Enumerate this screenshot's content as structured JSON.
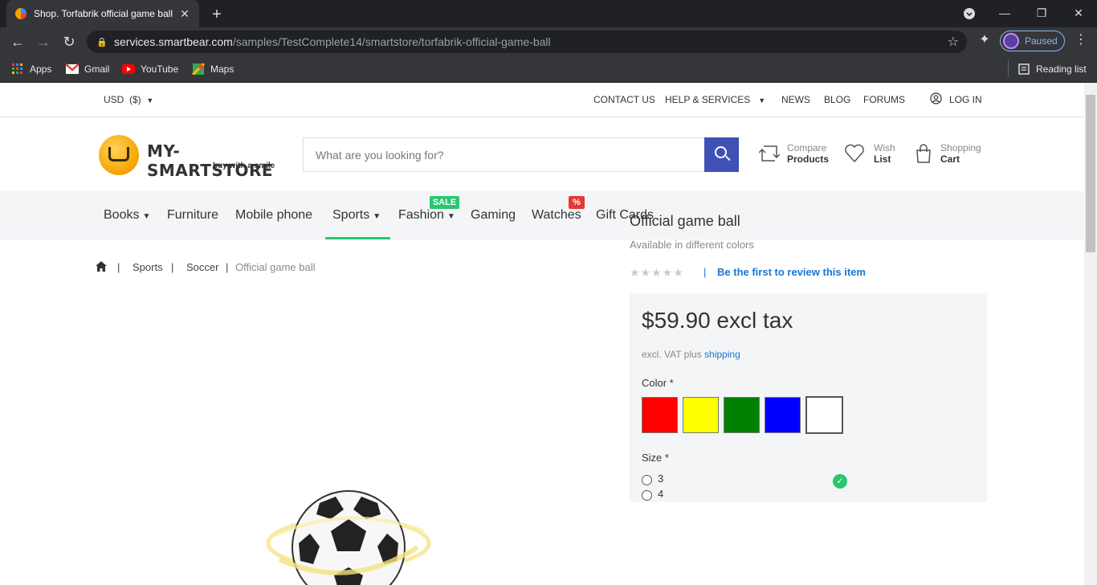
{
  "browser": {
    "tab_title": "Shop. Torfabrik official game ball",
    "url_host": "services.smartbear.com",
    "url_path": "/samples/TestComplete14/smartstore/torfabrik-official-game-ball",
    "profile_status": "Paused",
    "bookmarks": [
      "Apps",
      "Gmail",
      "YouTube",
      "Maps"
    ],
    "reading_list": "Reading list"
  },
  "topbar": {
    "currency": "USD",
    "currency_symbol": "($)",
    "contact": "CONTACT US",
    "help": "HELP & SERVICES",
    "news": "NEWS",
    "blog": "BLOG",
    "forums": "FORUMS",
    "login": "LOG IN"
  },
  "header": {
    "logo_name": "MY-SMARTSTORE",
    "logo_tagline": "buy with a smile",
    "search_placeholder": "What are you looking for?",
    "compare_l1": "Compare",
    "compare_l2": "Products",
    "wish_l1": "Wish",
    "wish_l2": "List",
    "cart_l1": "Shopping",
    "cart_l2": "Cart"
  },
  "menu": {
    "books": "Books",
    "furniture": "Furniture",
    "mobile": "Mobile phone",
    "sports": "Sports",
    "fashion": "Fashion",
    "gaming": "Gaming",
    "watches": "Watches",
    "giftcards": "Gift Cards",
    "sale_badge": "SALE",
    "pct_badge": "%"
  },
  "breadcrumb": {
    "sep": "|",
    "sports": "Sports",
    "soccer": "Soccer",
    "current": "Official game ball"
  },
  "product": {
    "title": "Official game ball",
    "subtitle": "Available in different colors",
    "stars": "★★★★★",
    "review_sep": "|",
    "review_link": "Be the first to review this item",
    "price": "$59.90 excl tax",
    "vat_text": "excl. VAT plus",
    "shipping_link": "shipping",
    "color_label": "Color *",
    "colors": [
      "#ff0000",
      "#ffff00",
      "#008000",
      "#0000ff",
      "#ffffff"
    ],
    "selected_color_index": 4,
    "size_label": "Size *",
    "sizes": [
      "3",
      "4"
    ]
  }
}
